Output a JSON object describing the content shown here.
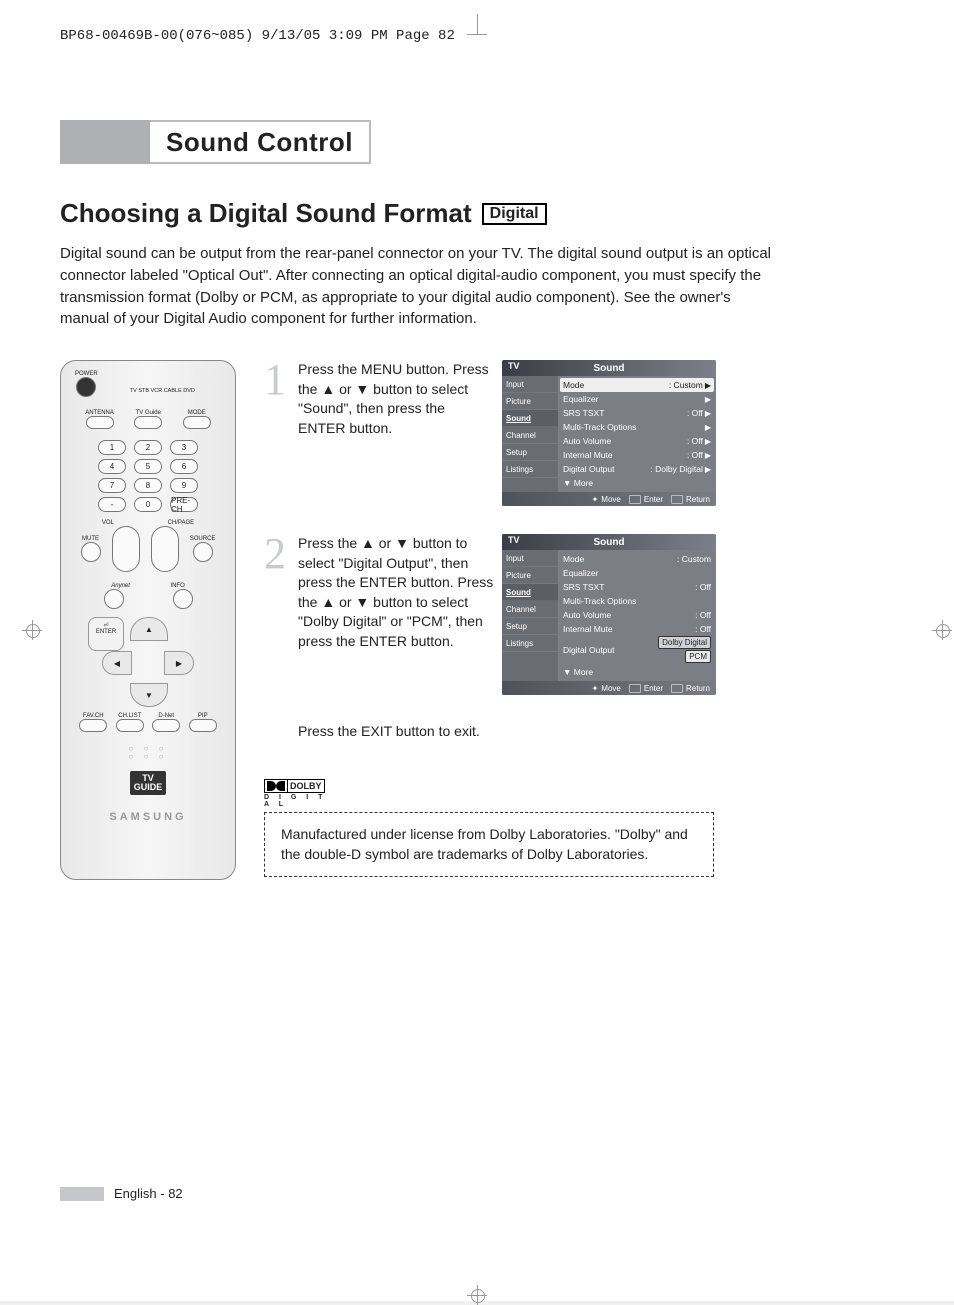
{
  "print_header": "BP68-00469B-00(076~085)  9/13/05  3:09 PM  Page 82",
  "title_bar": "Sound Control",
  "section": {
    "title": "Choosing a Digital Sound Format",
    "badge": "Digital"
  },
  "intro": "Digital sound can be output from the rear-panel connector on your TV. The digital sound output is an optical connector labeled \"Optical Out\". After connecting an optical digital-audio component, you must specify the transmission format (Dolby or PCM, as appropriate to your digital audio component). See the owner's manual of your Digital Audio component for further information.",
  "remote": {
    "power_label": "POWER",
    "mode_row": "TV  STB  VCR  CABLE  DVD",
    "row2": {
      "antenna": "ANTENNA",
      "tvguide": "TV Guide",
      "mode": "MODE"
    },
    "numbers": [
      [
        "1",
        "2",
        "3"
      ],
      [
        "4",
        "5",
        "6"
      ],
      [
        "7",
        "8",
        "9"
      ],
      [
        "-",
        "0",
        "PRE-CH"
      ]
    ],
    "vol": "VOL",
    "chpage": "CH/PAGE",
    "mute": "MUTE",
    "source": "SOURCE",
    "anynet": "Anynet",
    "info": "INFO",
    "enter": "ENTER",
    "bottom_row": [
      "FAV.CH",
      "CH.LIST",
      "D-Net",
      "PIP"
    ],
    "tvguide_logo_top": "TV",
    "tvguide_logo_bottom": "GUIDE",
    "brand": "SAMSUNG"
  },
  "steps": {
    "s1": {
      "num": "1",
      "text": "Press the MENU button. Press the ▲ or ▼ button to select \"Sound\", then press the ENTER button."
    },
    "s2": {
      "num": "2",
      "text": "Press the ▲ or ▼ button to select \"Digital Output\", then press the ENTER button. Press the ▲ or ▼ button to select \"Dolby Digital\" or \"PCM\", then press the ENTER button."
    },
    "exit": "Press the EXIT button to exit."
  },
  "osd_nav": [
    "Input",
    "Picture",
    "Sound",
    "Channel",
    "Setup",
    "Listings"
  ],
  "osd_common": {
    "tv_label": "TV",
    "title": "Sound",
    "more": "▼ More",
    "foot_move": "Move",
    "foot_enter": "Enter",
    "foot_return": "Return"
  },
  "osd1": {
    "rows": [
      {
        "name": "Mode",
        "val": ": Custom",
        "hl": true,
        "arrow": true
      },
      {
        "name": "Equalizer",
        "val": "",
        "arrow": true
      },
      {
        "name": "SRS TSXT",
        "val": ": Off",
        "arrow": true
      },
      {
        "name": "Multi-Track Options",
        "val": "",
        "arrow": true
      },
      {
        "name": "Auto Volume",
        "val": ": Off",
        "arrow": true
      },
      {
        "name": "Internal Mute",
        "val": ": Off",
        "arrow": true
      },
      {
        "name": "Digital Output",
        "val": ": Dolby Digital",
        "arrow": true
      }
    ]
  },
  "osd2": {
    "rows": [
      {
        "name": "Mode",
        "val": ": Custom"
      },
      {
        "name": "Equalizer",
        "val": ""
      },
      {
        "name": "SRS TSXT",
        "val": ": Off"
      },
      {
        "name": "Multi-Track Options",
        "val": ""
      },
      {
        "name": "Auto Volume",
        "val": ": Off"
      },
      {
        "name": "Internal Mute",
        "val": ": Off"
      },
      {
        "name": "Digital Output",
        "val": "",
        "options": [
          "Dolby Digital",
          "PCM"
        ],
        "selected": 0
      }
    ]
  },
  "dolby": {
    "word": "DOLBY",
    "sub": "D I G I T A L",
    "note": "Manufactured under license from Dolby Laboratories. \"Dolby\" and the double-D symbol are trademarks of Dolby Laboratories."
  },
  "footer": {
    "lang": "English - 82"
  }
}
